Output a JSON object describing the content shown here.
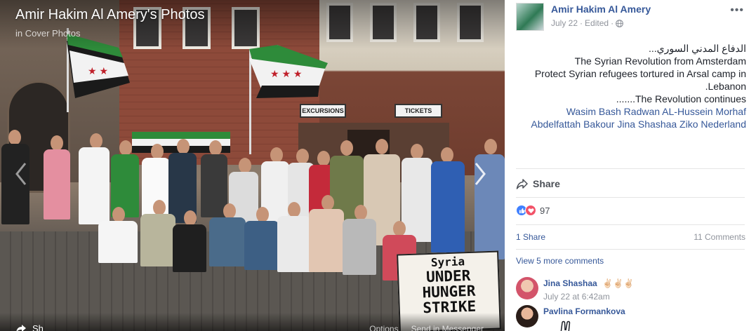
{
  "viewer": {
    "title": "Amir Hakim Al Amery's Photos",
    "album": "in Cover Photos",
    "signs": {
      "excursions": "EXCURSIONS",
      "tickets": "TICKETS"
    },
    "poster": {
      "line1": "Syria",
      "line2": "UNDER HUNGER",
      "line3": "STRIKE"
    },
    "bottom_left_label": "Sh",
    "bottom_right": [
      "Options",
      "Send in Messenger"
    ]
  },
  "post": {
    "author": "Amir Hakim Al Amery",
    "date": "July 22",
    "edited": "Edited",
    "privacy_icon": "globe-icon",
    "text_lines": [
      "الدفاع المدني السوري...",
      "The Syrian Revolution from Amsterdam",
      "Protect Syrian refugees tortured in Arsal camp in",
      ".Lebanon",
      ".......The Revolution continues"
    ],
    "tags_line1": "Wasim Bash Radwan AL-Hussein Morhaf",
    "tags_line2": "Abdelfattah Bakour Jina Shashaa Ziko Nederland"
  },
  "actions": {
    "share_label": "Share"
  },
  "reactions": {
    "count": "97"
  },
  "counts": {
    "shares": "1 Share",
    "comments": "11 Comments"
  },
  "comments_link": "View 5 more comments",
  "comments": [
    {
      "author": "Jina Shashaa",
      "text": "✌🏻✌🏻✌🏻",
      "time": "July 22 at 6:42am"
    },
    {
      "author": "Pavlina Formankova",
      "text": "",
      "time": ""
    }
  ],
  "colors": {
    "link": "#365899",
    "like": "#4080ff",
    "love": "#f25268"
  }
}
